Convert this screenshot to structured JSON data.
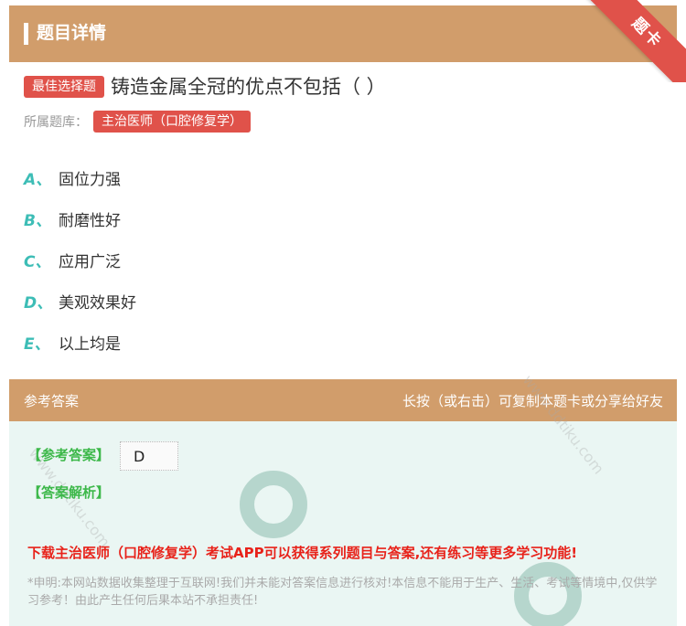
{
  "header": {
    "title": "题目详情",
    "ribbon": "题卡"
  },
  "question": {
    "type_tag": "最佳选择题",
    "text": "铸造金属全冠的优点不包括（ ）",
    "library_label": "所属题库：",
    "library_tag": "主治医师（口腔修复学）"
  },
  "options": [
    {
      "letter": "A、",
      "text": "固位力强"
    },
    {
      "letter": "B、",
      "text": "耐磨性好"
    },
    {
      "letter": "C、",
      "text": "应用广泛"
    },
    {
      "letter": "D、",
      "text": "美观效果好"
    },
    {
      "letter": "E、",
      "text": "以上均是"
    }
  ],
  "answer": {
    "head_left": "参考答案",
    "head_right": "长按（或右击）可复制本题卡或分享给好友",
    "answer_label": "【参考答案】",
    "answer_value": "D",
    "analysis_label": "【答案解析】",
    "download_text": "下载主治医师（口腔修复学）考试APP可以获得系列题目与答案,还有练习等更多学习功能!",
    "disclaimer": "*申明:本网站数据收集整理于互联网!我们并未能对答案信息进行核对!本信息不能用于生产、生活、考试等情境中,仅供学习参考！由此产生任何后果本站不承担责任!"
  },
  "colors": {
    "header_bg": "#d19d6b",
    "tag_red": "#e0524a",
    "option_letter": "#3dbdb6",
    "answer_green": "#3db84a",
    "download_red": "#e8221a"
  }
}
